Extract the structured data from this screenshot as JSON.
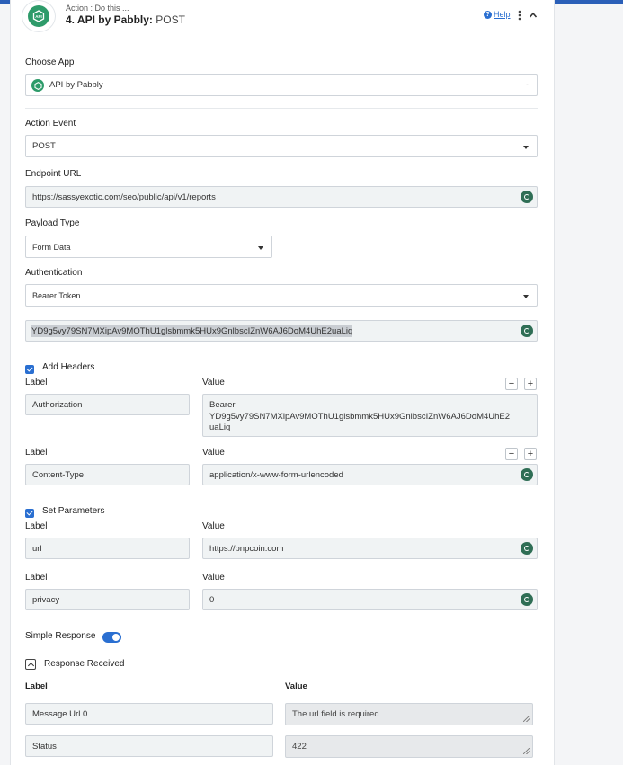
{
  "header": {
    "subtitle": "Action : Do this ...",
    "title": "4. API by Pabbly:",
    "method": "POST",
    "help_label": "Help"
  },
  "choose_app": {
    "label": "Choose App",
    "value": "API by Pabbly"
  },
  "action_event": {
    "label": "Action Event",
    "value": "POST"
  },
  "endpoint": {
    "label": "Endpoint URL",
    "value": "https://sassyexotic.com/seo/public/api/v1/reports"
  },
  "payload_type": {
    "label": "Payload Type",
    "value": "Form Data"
  },
  "authentication": {
    "label": "Authentication",
    "value": "Bearer Token",
    "token": "YD9g5vy79SN7MXipAv9MOThU1glsbmmk5HUx9GnlbscIZnW6AJ6DoM4UhE2uaLiq"
  },
  "headers": {
    "label": "Add Headers",
    "col_label": "Label",
    "col_value": "Value",
    "rows": [
      {
        "label": "Authorization",
        "value_line1": "Bearer",
        "value_line2": "YD9g5vy79SN7MXipAv9MOThU1glsbmmk5HUx9GnlbscIZnW6AJ6DoM4UhE2",
        "value_line3": "uaLiq"
      },
      {
        "label": "Content-Type",
        "value": "application/x-www-form-urlencoded"
      }
    ]
  },
  "parameters": {
    "label": "Set Parameters",
    "col_label": "Label",
    "col_value": "Value",
    "rows": [
      {
        "label": "url",
        "value": "https://pnpcoin.com"
      },
      {
        "label": "privacy",
        "value": "0"
      }
    ]
  },
  "simple_response": {
    "label": "Simple Response"
  },
  "response": {
    "title": "Response Received",
    "col_label": "Label",
    "col_value": "Value",
    "rows": [
      {
        "label": "Message Url 0",
        "value": "The url field is required."
      },
      {
        "label": "Status",
        "value": "422"
      }
    ]
  },
  "colors": {
    "accent": "#2a6fd1",
    "brand_green": "#2e9b6a",
    "top_bar": "#2a5fb8"
  },
  "icons": [
    "app-logo-icon",
    "help-icon",
    "kebab-icon",
    "chevron-up-icon",
    "caret-down-icon",
    "insert-data-icon",
    "checkbox-icon",
    "minus-icon",
    "plus-icon",
    "toggle-icon",
    "resize-handle-icon"
  ]
}
